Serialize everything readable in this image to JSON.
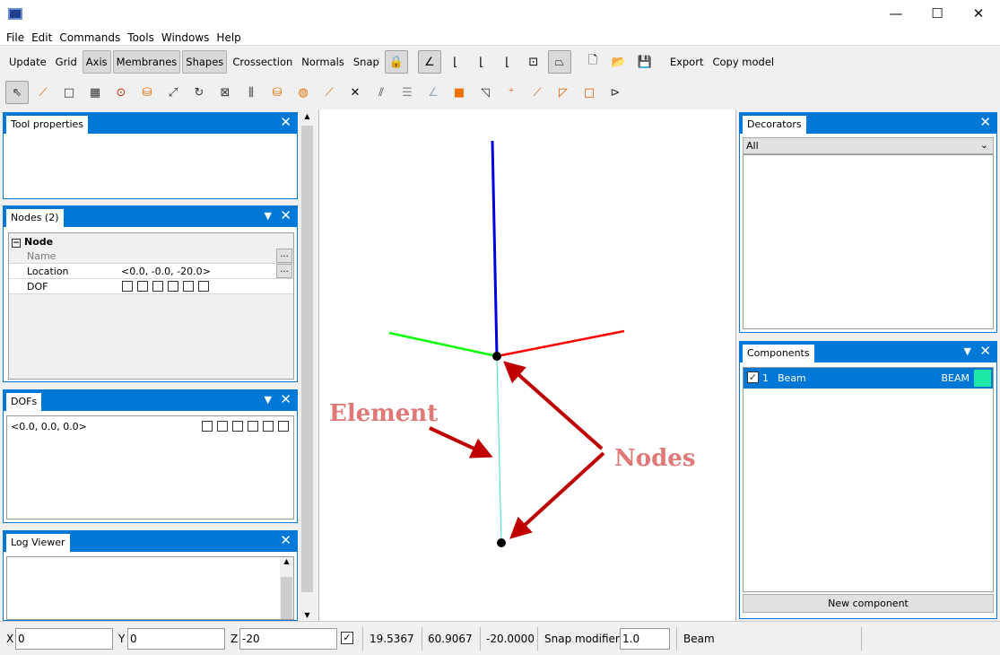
{
  "window": {
    "title": "",
    "controls": {
      "minimize": "—",
      "maximize": "☐",
      "close": "✕"
    }
  },
  "menu": [
    "File",
    "Edit",
    "Commands",
    "Tools",
    "Windows",
    "Help"
  ],
  "toolbar1": {
    "text_buttons": [
      {
        "label": "Update",
        "on": false
      },
      {
        "label": "Grid",
        "on": false
      },
      {
        "label": "Axis",
        "on": true
      },
      {
        "label": "Membranes",
        "on": true
      },
      {
        "label": "Shapes",
        "on": true
      },
      {
        "label": "Crossection",
        "on": false
      },
      {
        "label": "Normals",
        "on": false
      },
      {
        "label": "Snap",
        "on": false
      }
    ],
    "icons": [
      {
        "name": "snap-lock-icon",
        "glyph": "🔒",
        "on": true
      },
      {
        "name": "view-iso-icon",
        "glyph": "∠",
        "on": true
      },
      {
        "name": "view-xy-icon",
        "glyph": "⌊",
        "on": false
      },
      {
        "name": "view-xz-icon",
        "glyph": "⌊",
        "on": false
      },
      {
        "name": "view-yz-icon",
        "glyph": "⌊",
        "on": false
      },
      {
        "name": "fit-view-icon",
        "glyph": "⊡",
        "on": false
      },
      {
        "name": "perspective-icon",
        "glyph": "⏢",
        "on": true
      },
      {
        "name": "new-file-icon",
        "glyph": "🗋",
        "on": false
      },
      {
        "name": "open-folder-icon",
        "glyph": "📂",
        "on": false
      },
      {
        "name": "save-icon",
        "glyph": "💾",
        "on": false
      }
    ],
    "export_label": "Export",
    "copy_model_label": "Copy model"
  },
  "toolbar2": [
    {
      "name": "select-pointer-icon",
      "glyph": "⇖",
      "color": "#333",
      "on": true
    },
    {
      "name": "add-line-icon",
      "glyph": "⟋",
      "color": "#e05a00"
    },
    {
      "name": "add-rectangle-icon",
      "glyph": "□",
      "color": "#333"
    },
    {
      "name": "add-grid-rect-icon",
      "glyph": "▦",
      "color": "#333"
    },
    {
      "name": "add-circle-icon",
      "glyph": "⊙",
      "color": "#c03000"
    },
    {
      "name": "add-cylinder-icon",
      "glyph": "⛁",
      "color": "#e07000"
    },
    {
      "name": "move-icon",
      "glyph": "⤢",
      "color": "#333"
    },
    {
      "name": "rotate-icon",
      "glyph": "↻",
      "color": "#333"
    },
    {
      "name": "scale-icon",
      "glyph": "⊠",
      "color": "#333"
    },
    {
      "name": "array-icon",
      "glyph": "⫼",
      "color": "#333"
    },
    {
      "name": "cylinder-split-icon",
      "glyph": "⛁",
      "color": "#e07000"
    },
    {
      "name": "sphere-split-icon",
      "glyph": "◍",
      "color": "#e07000"
    },
    {
      "name": "line-segment-icon",
      "glyph": "⟋",
      "color": "#c08000"
    },
    {
      "name": "intersect-icon",
      "glyph": "✕",
      "color": "#000"
    },
    {
      "name": "parallel-icon",
      "glyph": "⫽",
      "color": "#333"
    },
    {
      "name": "beam-section-icon",
      "glyph": "☰",
      "color": "#888"
    },
    {
      "name": "angle-icon",
      "glyph": "∠",
      "color": "#9ab"
    },
    {
      "name": "add-membrane-icon",
      "glyph": "■",
      "color": "#f07000"
    },
    {
      "name": "add-triangle-rect-icon",
      "glyph": "◹",
      "color": "#333"
    },
    {
      "name": "add-node-icon",
      "glyph": "⁺",
      "color": "#e05a00"
    },
    {
      "name": "add-element-icon",
      "glyph": "⟋",
      "color": "#e05a00"
    },
    {
      "name": "add-triangle-icon",
      "glyph": "◸",
      "color": "#e05a00"
    },
    {
      "name": "add-quad-icon",
      "glyph": "□",
      "color": "#e05a00"
    },
    {
      "name": "link-icon",
      "glyph": "⊳",
      "color": "#333"
    }
  ],
  "panels": {
    "tool_properties": {
      "title": "Tool properties"
    },
    "nodes": {
      "title": "Nodes (2)",
      "group": "Node",
      "rows": [
        {
          "label": "Name",
          "value": ""
        },
        {
          "label": "Location",
          "value": "<0.0, -0.0, -20.0>"
        },
        {
          "label": "DOF",
          "value": ""
        }
      ],
      "ellipsis": "..."
    },
    "dofs": {
      "title": "DOFs",
      "value": "<0.0, 0.0, 0.0>"
    },
    "log": {
      "title": "Log Viewer"
    },
    "decorators": {
      "title": "Decorators",
      "filter": "All"
    },
    "components": {
      "title": "Components",
      "items": [
        {
          "index": "1",
          "name": "Beam",
          "type": "BEAM",
          "color": "#1de9a6",
          "checked": true
        }
      ],
      "new_button": "New component"
    }
  },
  "viewport": {
    "annotations": {
      "element": "Element",
      "nodes": "Nodes"
    },
    "colors": {
      "x_axis": "#ff0000",
      "y_axis": "#00ff00",
      "z_axis": "#0000dd",
      "element": "#40e0c0",
      "arrow": "#c00000",
      "label": "#e07878"
    }
  },
  "status": {
    "x_label": "X",
    "x": "0",
    "y_label": "Y",
    "y": "0",
    "z_label": "Z",
    "z": "-20",
    "lock_checked": true,
    "coord1": "19.5367",
    "coord2": "60.9067",
    "coord3": "-20.0000",
    "snap_label": "Snap modifier",
    "snap": "1.0",
    "component": "Beam"
  }
}
